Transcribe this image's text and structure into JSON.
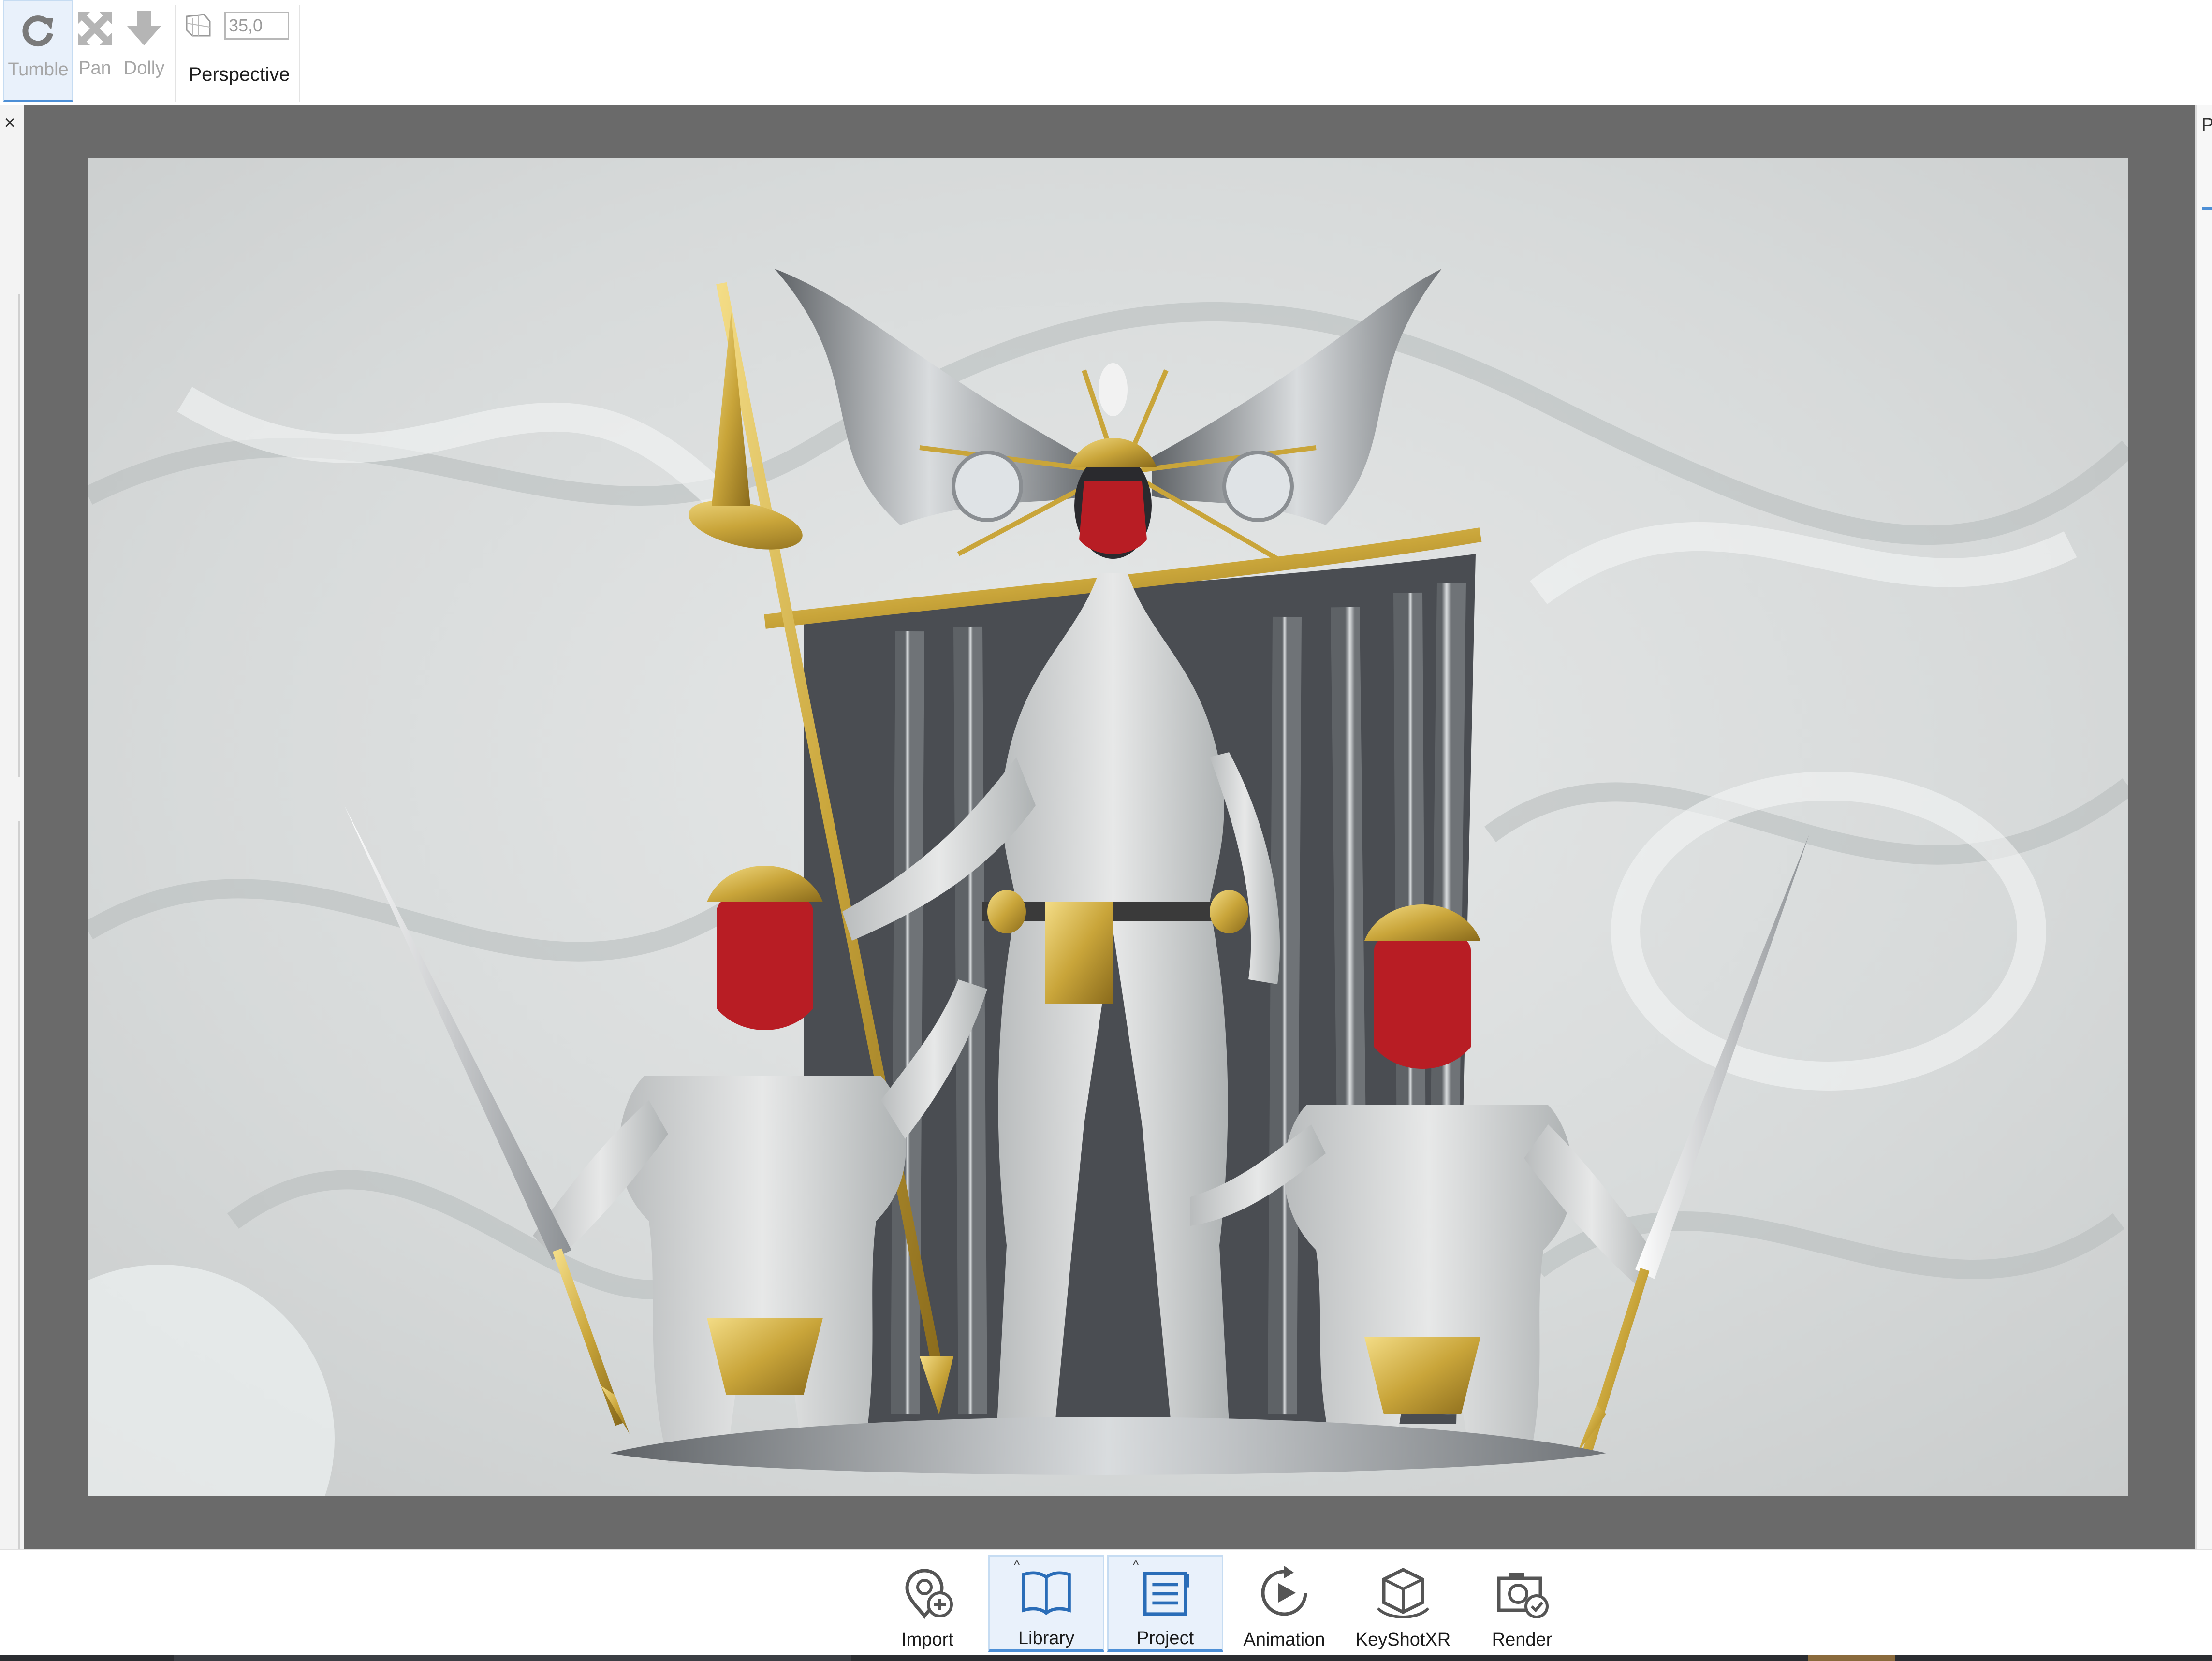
{
  "toolbar": {
    "tumble_label": "Tumble",
    "pan_label": "Pan",
    "dolly_label": "Dolly",
    "fov_value": "35,0",
    "perspective_label": "Perspective"
  },
  "right_panel": {
    "tab_initial": "P"
  },
  "left_panel": {
    "close_glyph": "×"
  },
  "ribbon": {
    "buttons": [
      {
        "label": "Import",
        "icon": "import-icon",
        "active": false
      },
      {
        "label": "Library",
        "icon": "library-book-icon",
        "active": true
      },
      {
        "label": "Project",
        "icon": "project-list-icon",
        "active": true
      },
      {
        "label": "Animation",
        "icon": "animation-play-icon",
        "active": false
      },
      {
        "label": "KeyShotXR",
        "icon": "keyshotxr-cube-icon",
        "active": false
      },
      {
        "label": "Render",
        "icon": "render-camera-icon",
        "active": false
      }
    ]
  },
  "colors": {
    "accent": "#4d8fd6",
    "viewport_bg": "#6a6a6a",
    "gold": "#c9a53a",
    "mask_red": "#b81d24"
  }
}
